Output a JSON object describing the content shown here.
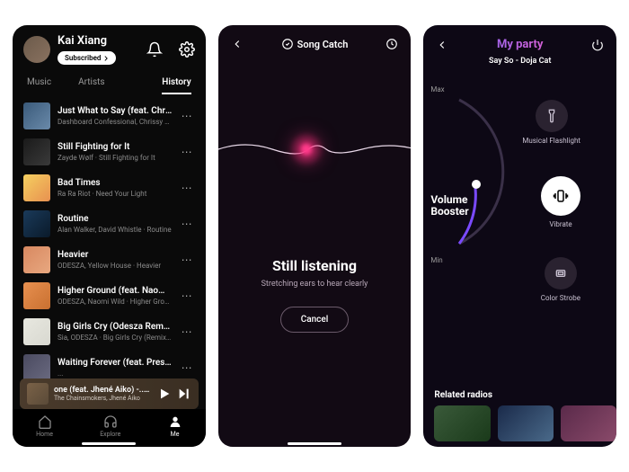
{
  "p1": {
    "user_name": "Kai Xiang",
    "subscribed_label": "Subscribed",
    "tabs": {
      "music": "Music",
      "artists": "Artists",
      "history": "History"
    },
    "tracks": [
      {
        "title": "Just What to Say (feat. Chrissy Co...",
        "sub": "Dashboard Confessional, Chrissy Costanza · ...",
        "art": "linear-gradient(135deg,#3a5a7a,#6a8aaa)"
      },
      {
        "title": "Still Fighting for It",
        "sub": "Zayde Wølf · Still Fighting for It",
        "art": "linear-gradient(135deg,#1a1a1a,#3a3a3a)"
      },
      {
        "title": "Bad Times",
        "sub": "Ra Ra Riot · Need Your Light",
        "art": "linear-gradient(135deg,#f5d060,#e89050)"
      },
      {
        "title": "Routine",
        "sub": "Alan Walker, David Whistle · Routine",
        "art": "linear-gradient(135deg,#1a3a5a,#0a1a2a)"
      },
      {
        "title": "Heavier",
        "sub": "ODESZA, Yellow House · Heavier",
        "art": "linear-gradient(135deg,#d88860,#e8a880)"
      },
      {
        "title": "Higher Ground (feat. Naomi Wild)",
        "sub": "ODESZA, Naomi Wild · Higher Ground",
        "art": "linear-gradient(135deg,#e89050,#c87030)"
      },
      {
        "title": "Big Girls Cry (Odesza Remix)",
        "sub": "Sia, ODESZA · Big Girls Cry (Remixes)",
        "art": "linear-gradient(135deg,#e8e8e0,#d8d8d0)"
      },
      {
        "title": "Waiting Forever (feat. Preston.)",
        "sub": "...",
        "art": "linear-gradient(135deg,#4a4a60,#6a6a80)"
      }
    ],
    "nowplaying": {
      "title": "one (feat. Jhené Aiko) -...   Wa",
      "sub": "The Chainsmokers, Jhené Aiko"
    },
    "nav": {
      "home": "Home",
      "explore": "Explore",
      "me": "Me"
    }
  },
  "p2": {
    "app_title": "Song Catch",
    "heading": "Still listening",
    "sub": "Stretching ears to hear clearly",
    "cancel": "Cancel"
  },
  "p3": {
    "title": "My party",
    "track": "Say So - Doja Cat",
    "max": "Max",
    "min": "Min",
    "vb1": "Volume",
    "vb2": "Booster",
    "flashlight": "Musical Flashlight",
    "vibrate": "Vibrate",
    "strobe": "Color Strobe",
    "related": "Related radios",
    "radios": [
      {
        "bg": "linear-gradient(135deg,#3a5a3a,#1a3a1a)"
      },
      {
        "bg": "linear-gradient(135deg,#1a2a4a,#4a6a8a)"
      },
      {
        "bg": "linear-gradient(135deg,#5a2a4a,#8a4a6a)"
      }
    ]
  }
}
